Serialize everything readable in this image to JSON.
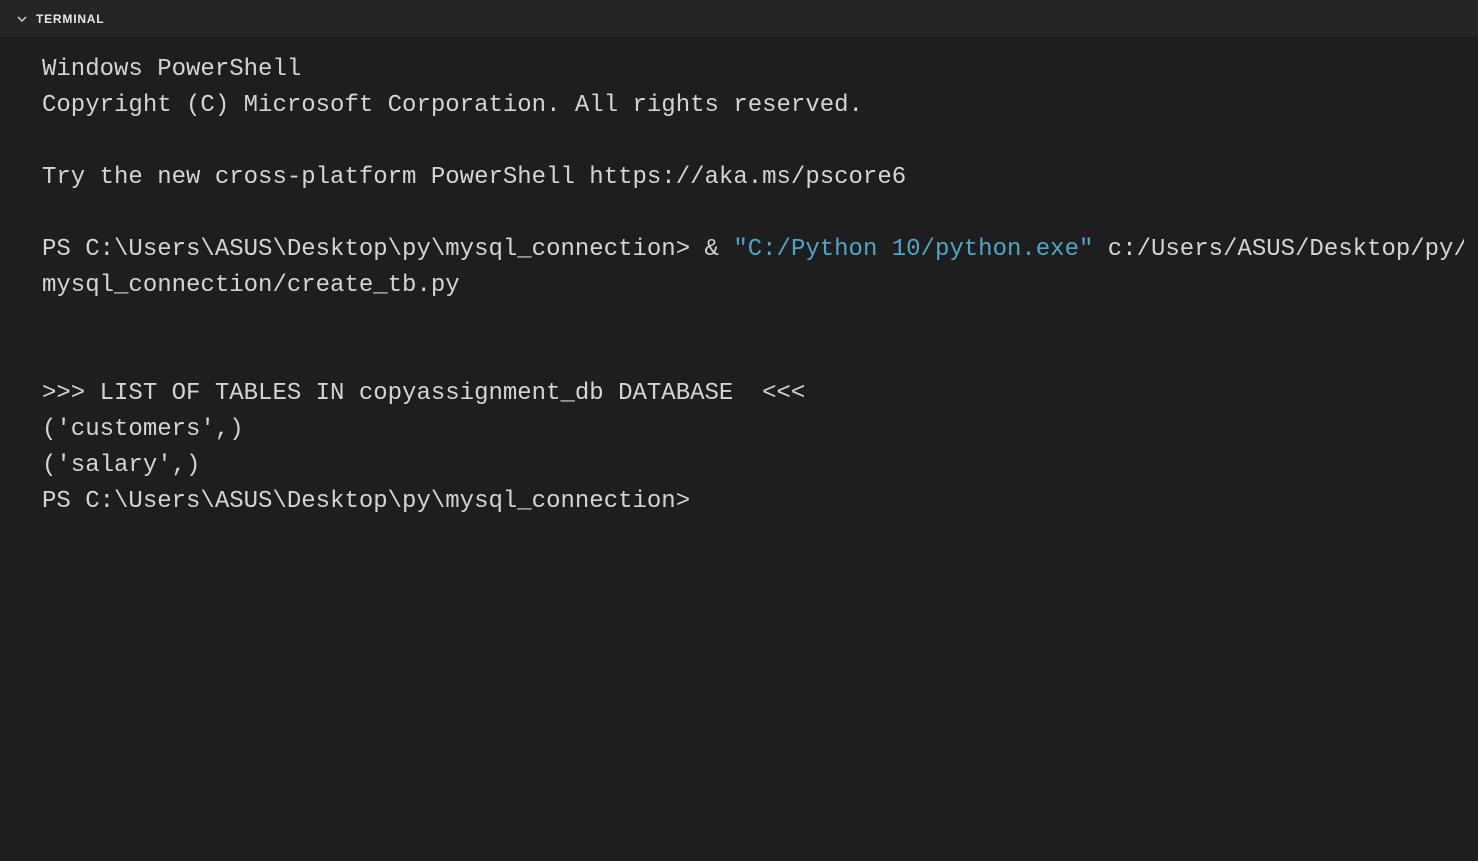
{
  "header": {
    "tab_label": "TERMINAL"
  },
  "terminal": {
    "line1": "Windows PowerShell",
    "line2": "Copyright (C) Microsoft Corporation. All rights reserved.",
    "line3": "Try the new cross-platform PowerShell https://aka.ms/pscore6",
    "prompt1_pre": "PS C:\\Users\\ASUS\\Desktop\\py\\mysql_connection> ",
    "prompt1_op": "& ",
    "prompt1_str": "\"C:/Python 10/python.exe\"",
    "prompt1_arg": " c:/Users/ASUS/Desktop/py/mysql_connection/create_tb.py",
    "output1": ">>> LIST OF TABLES IN copyassignment_db DATABASE  <<<",
    "output2": "('customers',)",
    "output3": "('salary',)",
    "prompt2": "PS C:\\Users\\ASUS\\Desktop\\py\\mysql_connection>"
  }
}
